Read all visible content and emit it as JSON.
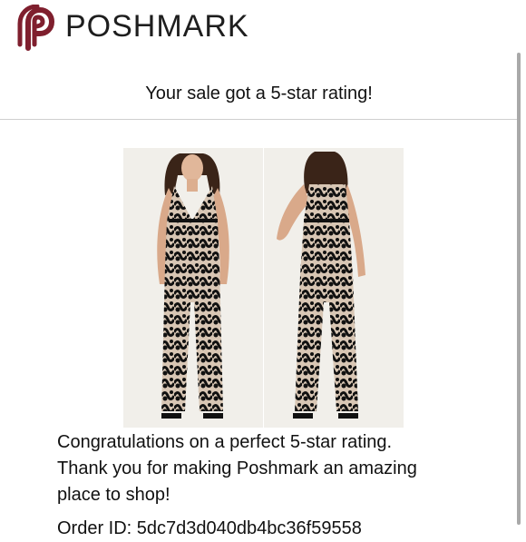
{
  "brand": {
    "name": "POSHMARK",
    "icon": "poshmark-logo-icon",
    "color": "#7f1f2e"
  },
  "banner": {
    "text": "Your sale got a 5-star rating!"
  },
  "product_images": [
    {
      "icon": "jumpsuit-front-photo"
    },
    {
      "icon": "jumpsuit-back-photo"
    }
  ],
  "message": {
    "line1": "Congratulations on a perfect 5-star rating.",
    "line2": "Thank you for making Poshmark an amazing",
    "line3": "place to shop!"
  },
  "order": {
    "text": "Order ID: 5dc7d3d040db4bc36f59558"
  }
}
